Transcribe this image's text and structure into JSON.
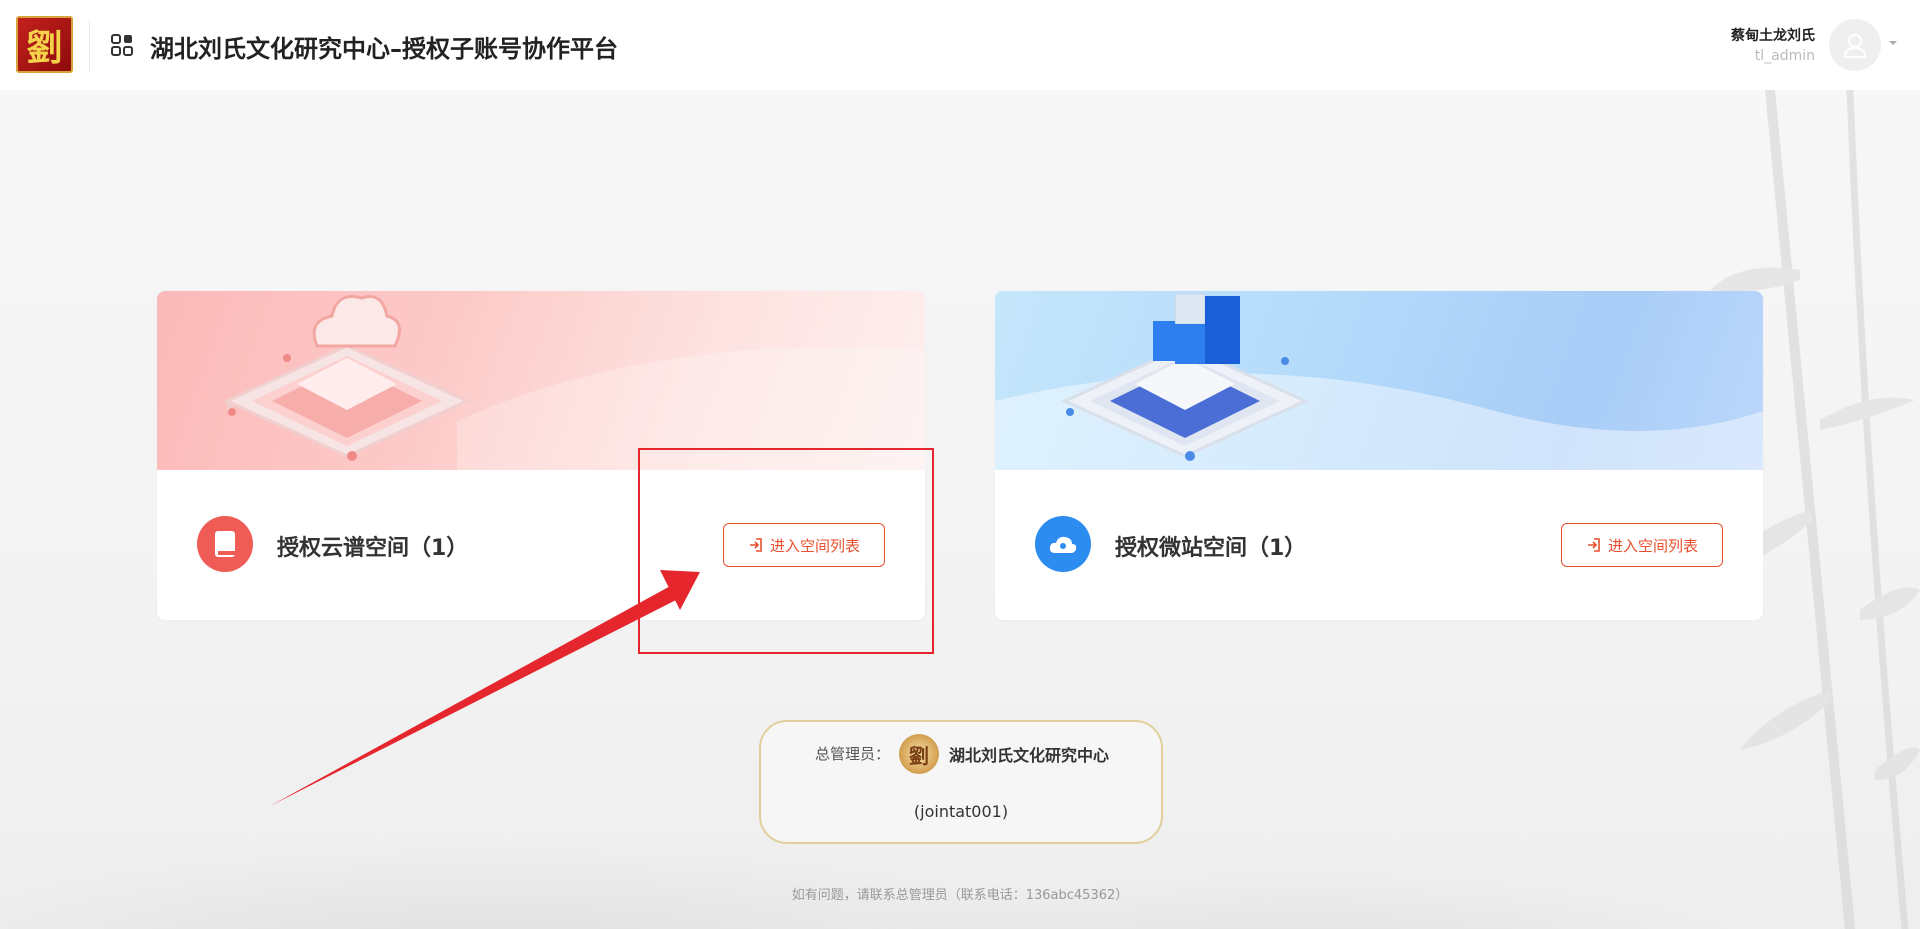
{
  "header": {
    "logo_char": "劉",
    "title": "湖北刘氏文化研究中心–授权子账号协作平台",
    "user": {
      "name": "蔡甸土龙刘氏",
      "id": "tl_admin"
    }
  },
  "cards": [
    {
      "title": "授权云谱空间（1）",
      "button_label": "进入空间列表",
      "icon": "book-icon",
      "theme": "pink"
    },
    {
      "title": "授权微站空间（1）",
      "button_label": "进入空间列表",
      "icon": "cloud-icon",
      "theme": "blue"
    }
  ],
  "admin": {
    "label": "总管理员：",
    "logo_char": "劉",
    "name": "湖北刘氏文化研究中心",
    "account": "(jointat001)"
  },
  "footer": {
    "note": "如有问题，请联系总管理员（联系电话：136abc45362）"
  },
  "colors": {
    "accent": "#e8502f",
    "red_icon": "#ef5b55",
    "blue_icon": "#2d8cf0",
    "annotation": "#e5262c",
    "gold_border": "#e0cf9b"
  }
}
